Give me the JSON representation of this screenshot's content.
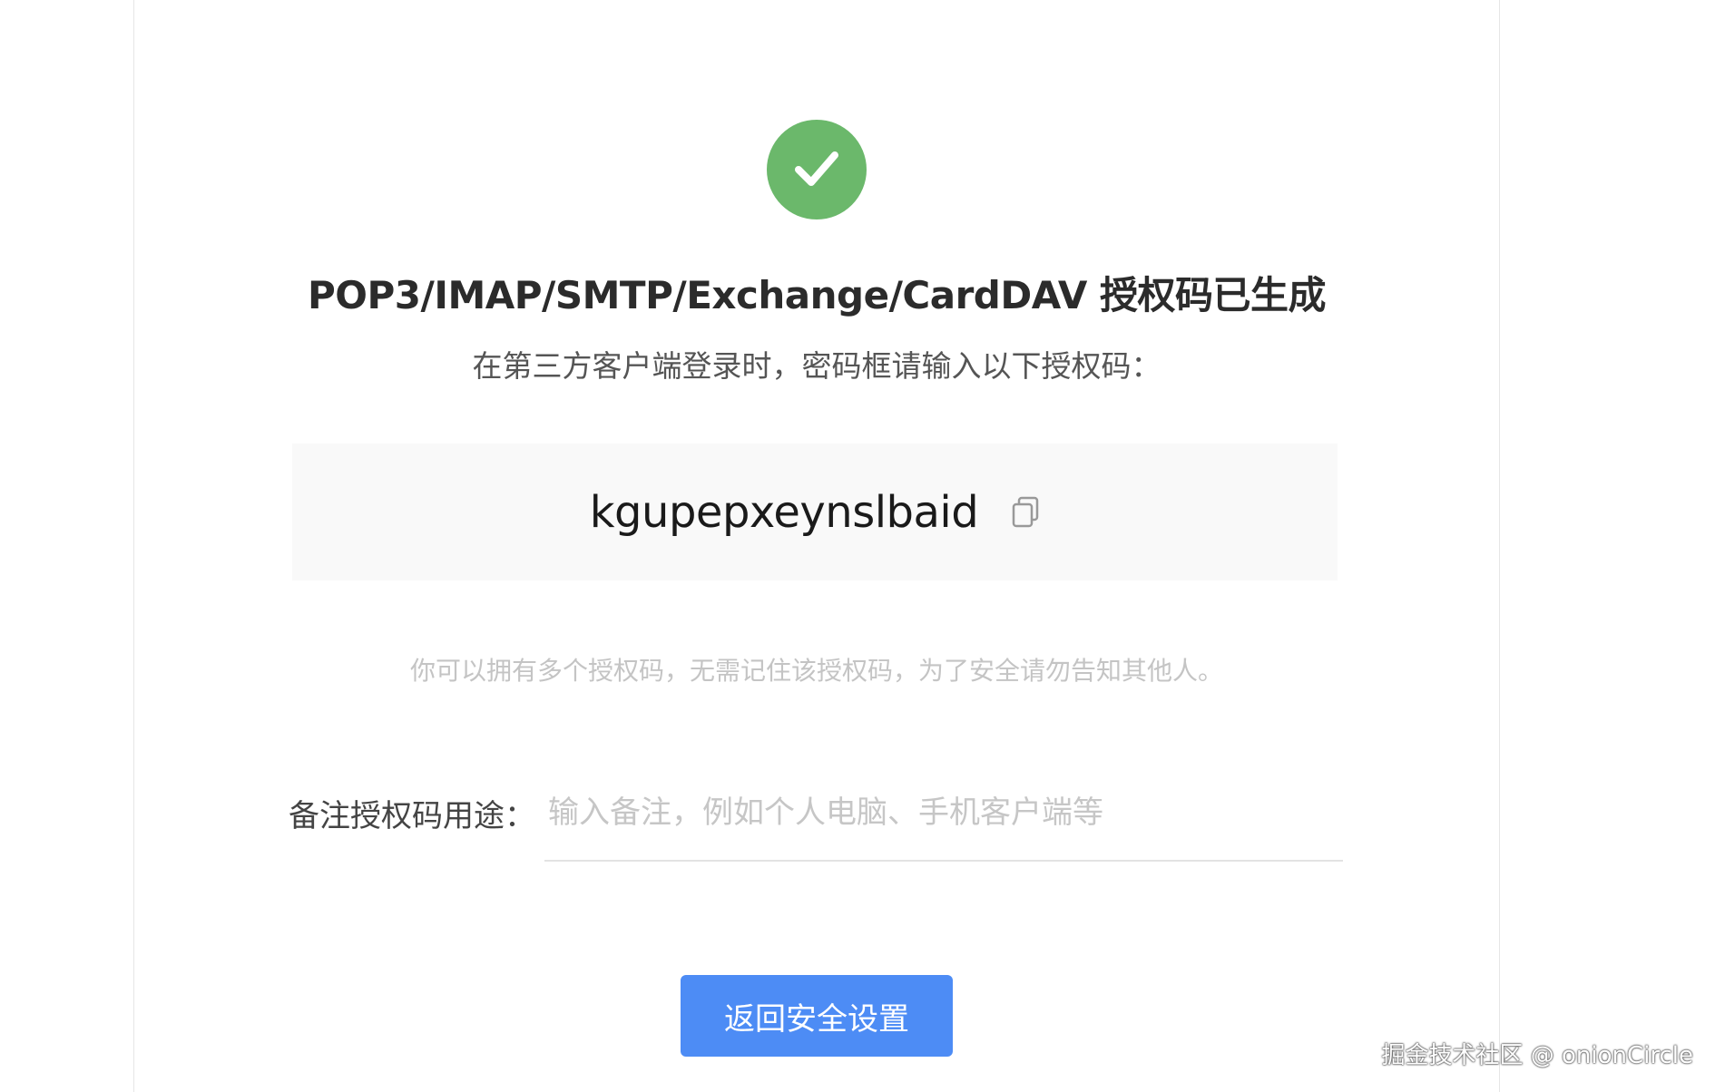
{
  "header": {
    "title": "POP3/IMAP/SMTP/Exchange/CardDAV 授权码已生成",
    "subtitle": "在第三方客户端登录时，密码框请输入以下授权码："
  },
  "auth_code": {
    "value": "kgupepxeynslbaid"
  },
  "note": "你可以拥有多个授权码，无需记住该授权码，为了安全请勿告知其他人。",
  "form": {
    "label": "备注授权码用途：",
    "value": "",
    "placeholder": "输入备注，例如个人电脑、手机客户端等"
  },
  "actions": {
    "back_label": "返回安全设置"
  },
  "watermark": "掘金技术社区 @ onionCircle",
  "colors": {
    "success": "#6bb86b",
    "primary": "#4d8cf5"
  },
  "icons": {
    "status": "check-circle-icon",
    "copy": "copy-icon"
  }
}
